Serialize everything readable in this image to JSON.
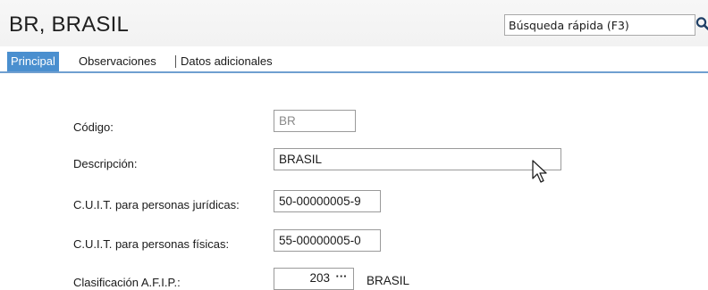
{
  "header": {
    "title": "BR, BRASIL"
  },
  "search": {
    "placeholder": "Búsqueda rápida (F3)"
  },
  "tabs": [
    {
      "label": "Principal"
    },
    {
      "label": "Observaciones"
    },
    {
      "label": "Datos adicionales"
    }
  ],
  "form": {
    "codigo": {
      "label": "Código:",
      "value": "BR"
    },
    "descripcion": {
      "label": "Descripción:",
      "value": "BRASIL"
    },
    "cuit_juridicas": {
      "label": "C.U.I.T. para personas jurídicas:",
      "value": "50-00000005-9"
    },
    "cuit_fisicas": {
      "label": "C.U.I.T. para personas físicas:",
      "value": "55-00000005-0"
    },
    "afip": {
      "label": "Clasificación A.F.I.P.:",
      "code": "203",
      "button": "···",
      "description": "BRASIL"
    }
  },
  "colors": {
    "active_tab": "#4a8fcf",
    "tab_underline": "#6f9fd0"
  },
  "icons": {
    "search": "magnifier-icon",
    "cursor": "mouse-pointer-icon"
  }
}
